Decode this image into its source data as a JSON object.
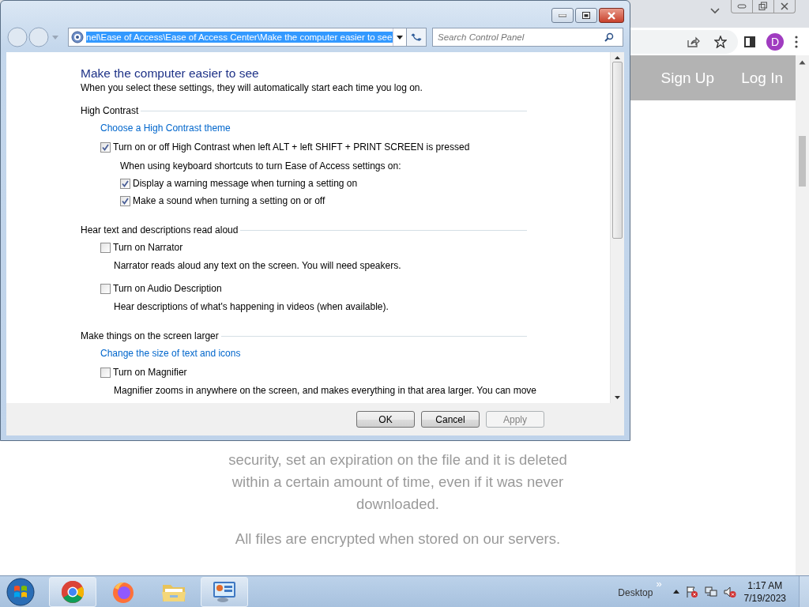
{
  "browser": {
    "avatar": "D",
    "nav_links": [
      "Sign Up",
      "Log In"
    ],
    "paragraphs": [
      "security, set an expiration on the file and it is deleted within a certain amount of time, even if it was never downloaded.",
      "All files are encrypted when stored on our servers."
    ]
  },
  "dialog": {
    "address": {
      "value": "nel\\Ease of Access\\Ease of Access Center\\Make the computer easier to see",
      "selected": true
    },
    "search": {
      "placeholder": "Search Control Panel"
    },
    "title": "Make the computer easier to see",
    "subtitle": "When you select these settings, they will automatically start each time you log on.",
    "sections": [
      {
        "title": "High Contrast",
        "items": [
          {
            "kind": "link",
            "text": "Choose a High Contrast theme"
          },
          {
            "kind": "checkbox",
            "label": "Turn on or off High Contrast when left ALT + left SHIFT + PRINT SCREEN is pressed",
            "checked": true,
            "children": [
              {
                "kind": "note",
                "text": "When using keyboard shortcuts to turn Ease of Access settings on:"
              },
              {
                "kind": "checkbox",
                "label": "Display a warning message when turning a setting on",
                "checked": true
              },
              {
                "kind": "checkbox",
                "label": "Make a sound when turning a setting on or off",
                "checked": true
              }
            ]
          }
        ]
      },
      {
        "title": "Hear text and descriptions read aloud",
        "items": [
          {
            "kind": "checkbox",
            "label": "Turn on Narrator",
            "checked": false,
            "description": "Narrator reads aloud any text on the screen. You will need speakers."
          },
          {
            "kind": "checkbox",
            "label": "Turn on Audio Description",
            "checked": false,
            "description": "Hear descriptions of what's happening in videos (when available)."
          }
        ]
      },
      {
        "title": "Make things on the screen larger",
        "items": [
          {
            "kind": "link",
            "text": "Change the size of text and icons"
          },
          {
            "kind": "checkbox",
            "label": "Turn on Magnifier",
            "checked": false,
            "description": "Magnifier zooms in anywhere on the screen, and makes everything in that area larger. You can move"
          }
        ]
      }
    ],
    "buttons": [
      {
        "label": "OK",
        "disabled": false
      },
      {
        "label": "Cancel",
        "disabled": false
      },
      {
        "label": "Apply",
        "disabled": true
      }
    ]
  },
  "taskbar": {
    "apps": [
      {
        "kind": "chrome",
        "open": true
      },
      {
        "kind": "firefox",
        "open": false
      },
      {
        "kind": "folder",
        "open": false
      },
      {
        "kind": "control-panel",
        "open": true
      }
    ],
    "desktop_label": "Desktop",
    "overflow": "»",
    "time": "1:17 AM",
    "date": "7/19/2023"
  }
}
